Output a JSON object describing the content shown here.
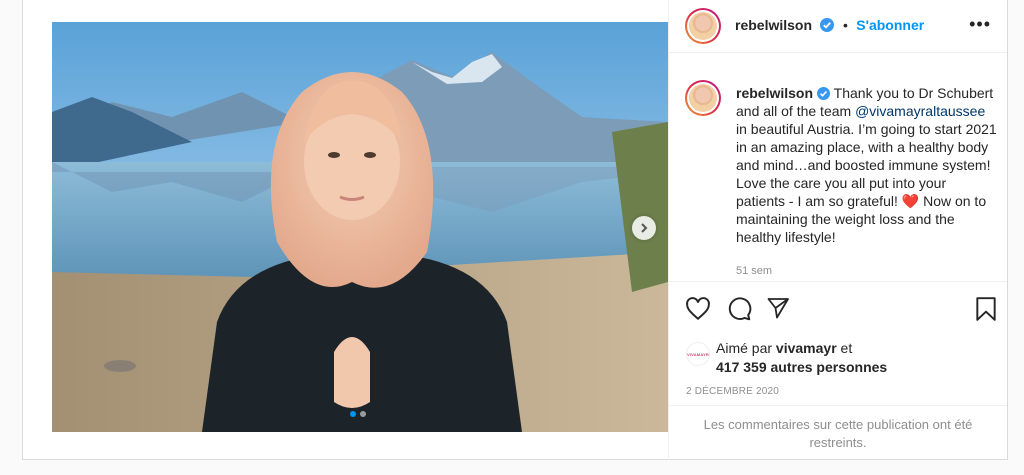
{
  "post": {
    "author": "rebelwilson",
    "follow_label": "S'abonner",
    "more_label": "•••",
    "caption_lead": "Thank you to Dr Schubert and all of the team ",
    "caption_mention": "@vivamayraltaussee",
    "caption_mid": " in beautiful Austria. I’m going to start 2021 in an amazing place, with a healthy body and mind…and boosted immune system! Love the care you all put into your patients - I am so grateful! ",
    "caption_emoji": "❤️",
    "caption_tail": " Now on to maintaining the weight loss and the healthy lifestyle!",
    "time_ago": "51 sem",
    "liked_prefix": "Aimé par ",
    "liked_user": "vivamayr",
    "liked_suffix": " et",
    "likes_count": "417 359 autres personnes",
    "liker_avatar_text": "VIVAMAYR",
    "date": "2 DÉCEMBRE 2020",
    "comments_restricted": "Les commentaires sur cette publication ont été restreints."
  },
  "carousel": {
    "total": 2,
    "current": 1
  },
  "icons": {
    "like": "heart-icon",
    "comment": "comment-icon",
    "share": "share-icon",
    "save": "bookmark-icon",
    "verified": "verified-badge-icon",
    "next": "chevron-right-icon"
  },
  "colors": {
    "link": "#0095f6",
    "mention": "#00376b",
    "muted": "#8e8e8e",
    "heart": "#e0245e"
  }
}
